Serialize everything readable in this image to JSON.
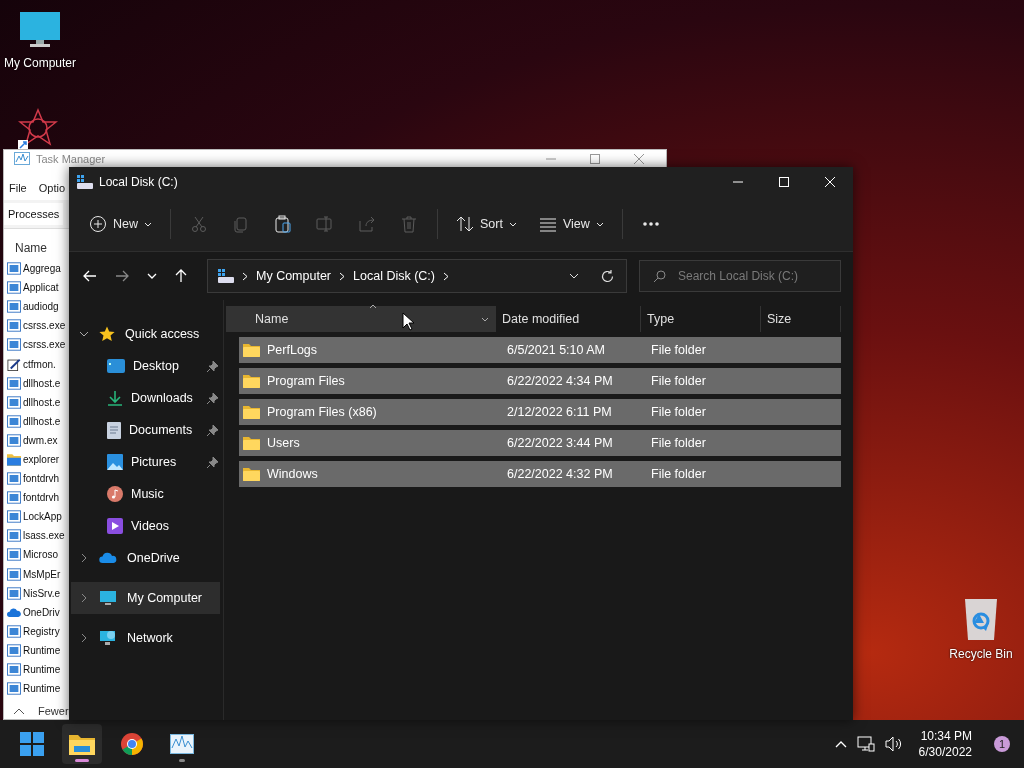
{
  "desktop_icons": [
    {
      "kind": "computer",
      "label": "My Computer"
    },
    {
      "kind": "recycle",
      "label": "Recycle Bin"
    }
  ],
  "task_manager": {
    "title": "Task Manager",
    "menu": [
      "File",
      "Optio"
    ],
    "tabs": [
      {
        "label": "Processes",
        "selected": true
      }
    ],
    "column": "Name",
    "processes": [
      {
        "name": "Aggrega",
        "kind": "app"
      },
      {
        "name": "Applicat",
        "kind": "app"
      },
      {
        "name": "audiodg",
        "kind": "app"
      },
      {
        "name": "csrss.exe",
        "kind": "app"
      },
      {
        "name": "csrss.exe",
        "kind": "app"
      },
      {
        "name": "ctfmon.",
        "kind": "pen"
      },
      {
        "name": "dllhost.e",
        "kind": "app"
      },
      {
        "name": "dllhost.e",
        "kind": "app"
      },
      {
        "name": "dllhost.e",
        "kind": "app"
      },
      {
        "name": "dwm.ex",
        "kind": "app"
      },
      {
        "name": "explorer",
        "kind": "folder"
      },
      {
        "name": "fontdrvh",
        "kind": "app"
      },
      {
        "name": "fontdrvh",
        "kind": "app"
      },
      {
        "name": "LockApp",
        "kind": "app"
      },
      {
        "name": "lsass.exe",
        "kind": "app"
      },
      {
        "name": "Microso",
        "kind": "app"
      },
      {
        "name": "MsMpEr",
        "kind": "app"
      },
      {
        "name": "NisSrv.e",
        "kind": "app"
      },
      {
        "name": "OneDriv",
        "kind": "cloud"
      },
      {
        "name": "Registry",
        "kind": "app"
      },
      {
        "name": "Runtime",
        "kind": "app"
      },
      {
        "name": "Runtime",
        "kind": "app"
      },
      {
        "name": "Runtime",
        "kind": "app"
      }
    ],
    "footer": "Fewer"
  },
  "explorer": {
    "title": "Local Disk (C:)",
    "toolbar": [
      {
        "kind": "new",
        "label": "New",
        "disabled": false
      },
      {
        "kind": "cut",
        "disabled": true
      },
      {
        "kind": "copy",
        "disabled": true
      },
      {
        "kind": "paste",
        "disabled": false
      },
      {
        "kind": "rename",
        "disabled": true
      },
      {
        "kind": "share",
        "disabled": true
      },
      {
        "kind": "delete",
        "disabled": true
      },
      {
        "kind": "sort",
        "label": "Sort",
        "disabled": false
      },
      {
        "kind": "view",
        "label": "View",
        "disabled": false
      },
      {
        "kind": "more",
        "disabled": false
      }
    ],
    "breadcrumb": [
      "My Computer",
      "Local Disk (C:)"
    ],
    "search": {
      "placeholder": "Search Local Disk (C:)"
    },
    "nav": [
      {
        "label": "Quick access",
        "kind": "star",
        "expanded": true,
        "selected": false,
        "children": [
          {
            "label": "Desktop",
            "kind": "desktop",
            "pinned": true,
            "selected": false
          },
          {
            "label": "Downloads",
            "kind": "download",
            "pinned": true,
            "selected": false
          },
          {
            "label": "Documents",
            "kind": "document",
            "pinned": true,
            "selected": false
          },
          {
            "label": "Pictures",
            "kind": "pictures",
            "pinned": true,
            "selected": false
          },
          {
            "label": "Music",
            "kind": "music",
            "pinned": false,
            "selected": false
          },
          {
            "label": "Videos",
            "kind": "videos",
            "pinned": false,
            "selected": false
          }
        ]
      },
      {
        "label": "OneDrive",
        "kind": "cloud",
        "expanded": false,
        "selected": false
      },
      {
        "label": "My Computer",
        "kind": "computer",
        "expanded": false,
        "selected": true
      },
      {
        "label": "Network",
        "kind": "network",
        "expanded": false,
        "selected": false
      }
    ],
    "columns": [
      {
        "label": "Name",
        "sorted": true
      },
      {
        "label": "Date modified",
        "sorted": false
      },
      {
        "label": "Type",
        "sorted": false
      },
      {
        "label": "Size",
        "sorted": false
      }
    ],
    "rows": [
      {
        "name": "PerfLogs",
        "date": "6/5/2021 5:10 AM",
        "type": "File folder",
        "selected": true
      },
      {
        "name": "Program Files",
        "date": "6/22/2022 4:34 PM",
        "type": "File folder",
        "selected": true
      },
      {
        "name": "Program Files (x86)",
        "date": "2/12/2022 6:11 PM",
        "type": "File folder",
        "selected": true
      },
      {
        "name": "Users",
        "date": "6/22/2022 3:44 PM",
        "type": "File folder",
        "selected": true
      },
      {
        "name": "Windows",
        "date": "6/22/2022 4:32 PM",
        "type": "File folder",
        "selected": true
      }
    ]
  },
  "taskbar": {
    "apps": [
      {
        "kind": "start",
        "running": false,
        "active": false
      },
      {
        "kind": "explorer",
        "running": true,
        "active": true
      },
      {
        "kind": "browser",
        "running": false,
        "active": false
      },
      {
        "kind": "monitor",
        "running": true,
        "active": false
      }
    ],
    "time": "10:34 PM",
    "date": "6/30/2022",
    "notifications": "1"
  }
}
